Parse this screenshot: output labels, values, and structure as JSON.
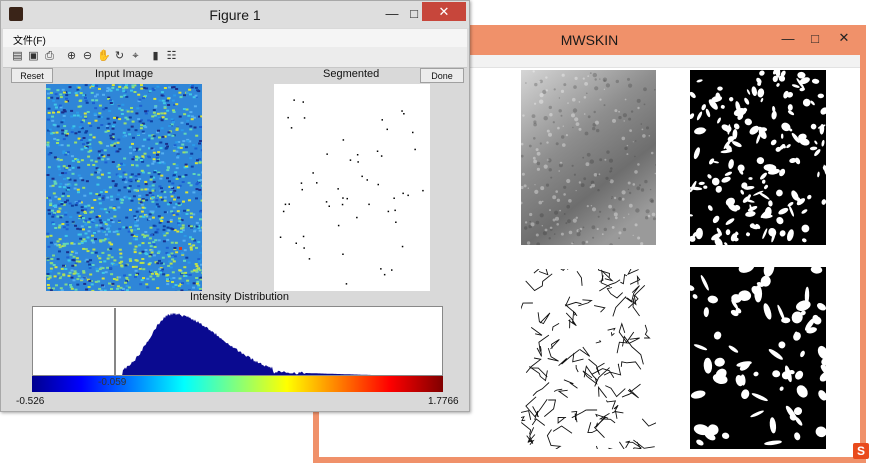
{
  "mwskin": {
    "title": "MWSKIN",
    "controls": {
      "minimize": "—",
      "maximize": "□",
      "close": "✕"
    },
    "tray_icon": "S"
  },
  "figure": {
    "title": "Figure 1",
    "controls": {
      "minimize": "—",
      "maximize": "□",
      "close": "✕"
    },
    "menu": {
      "file": "文件(F)"
    },
    "toolbar_icons": [
      "open-icon",
      "save-icon",
      "print-icon",
      "zoom-in-icon",
      "zoom-out-icon",
      "pan-icon",
      "rotate-icon",
      "data-cursor-icon",
      "colorbar-icon",
      "legend-icon"
    ],
    "buttons": {
      "reset": "Reset",
      "done": "Done"
    },
    "labels": {
      "input_image": "Input Image",
      "segmented": "Segmented",
      "intensity_distribution": "Intensity Distribution"
    },
    "histogram": {
      "threshold_value": "-0.059",
      "axis_min": "-0.526",
      "axis_max": "1.7766"
    }
  }
}
